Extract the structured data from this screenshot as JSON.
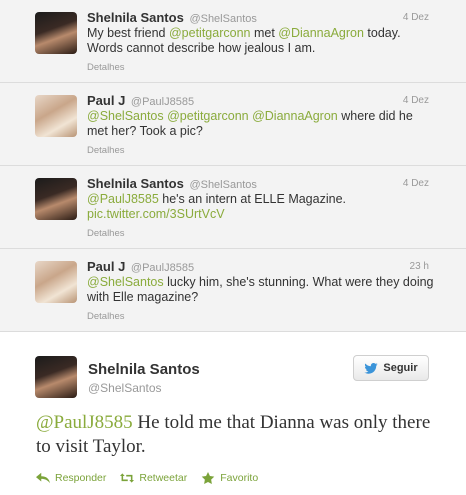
{
  "thread": [
    {
      "name": "Shelnila Santos",
      "handle": "@ShelSantos",
      "time": "4 Dez",
      "segments": [
        {
          "text": "My best friend ",
          "link": false
        },
        {
          "text": "@petitgarconn",
          "link": true
        },
        {
          "text": " met ",
          "link": false
        },
        {
          "text": "@DiannaAgron",
          "link": true
        },
        {
          "text": " today. Words cannot describe how jealous I am.",
          "link": false
        }
      ],
      "details": "Detalhes",
      "avatar": "shelnila-avatar"
    },
    {
      "name": "Paul J",
      "handle": "@PaulJ8585",
      "time": "4 Dez",
      "segments": [
        {
          "text": "@ShelSantos",
          "link": true
        },
        {
          "text": " ",
          "link": false
        },
        {
          "text": "@petitgarconn",
          "link": true
        },
        {
          "text": " ",
          "link": false
        },
        {
          "text": "@DiannaAgron",
          "link": true
        },
        {
          "text": " where did he met her? Took a pic?",
          "link": false
        }
      ],
      "details": "Detalhes",
      "avatar": "paul-avatar"
    },
    {
      "name": "Shelnila Santos",
      "handle": "@ShelSantos",
      "time": "4 Dez",
      "segments": [
        {
          "text": "@PaulJ8585",
          "link": true
        },
        {
          "text": " he's an intern at ELLE Magazine. ",
          "link": false
        },
        {
          "text": "pic.twitter.com/3SUrtVcV",
          "link": true
        }
      ],
      "details": "Detalhes",
      "avatar": "shelnila-avatar"
    },
    {
      "name": "Paul J",
      "handle": "@PaulJ8585",
      "time": "23 h",
      "segments": [
        {
          "text": "@ShelSantos",
          "link": true
        },
        {
          "text": " lucky him, she's stunning. What were they doing with Elle magazine?",
          "link": false
        }
      ],
      "details": "Detalhes",
      "avatar": "paul-avatar"
    }
  ],
  "main": {
    "name": "Shelnila Santos",
    "handle": "@ShelSantos",
    "follow_label": "Seguir",
    "mention": "@PaulJ8585",
    "text": " He told me that Dianna was only there to visit Taylor.",
    "actions": {
      "reply": "Responder",
      "retweet": "Retweetar",
      "favorite": "Favorito"
    }
  },
  "colors": {
    "link": "#8aab3c",
    "action": "#7ba33a",
    "thread_bg": "#f3f3f3",
    "follow_bird": "#3b94d9"
  }
}
